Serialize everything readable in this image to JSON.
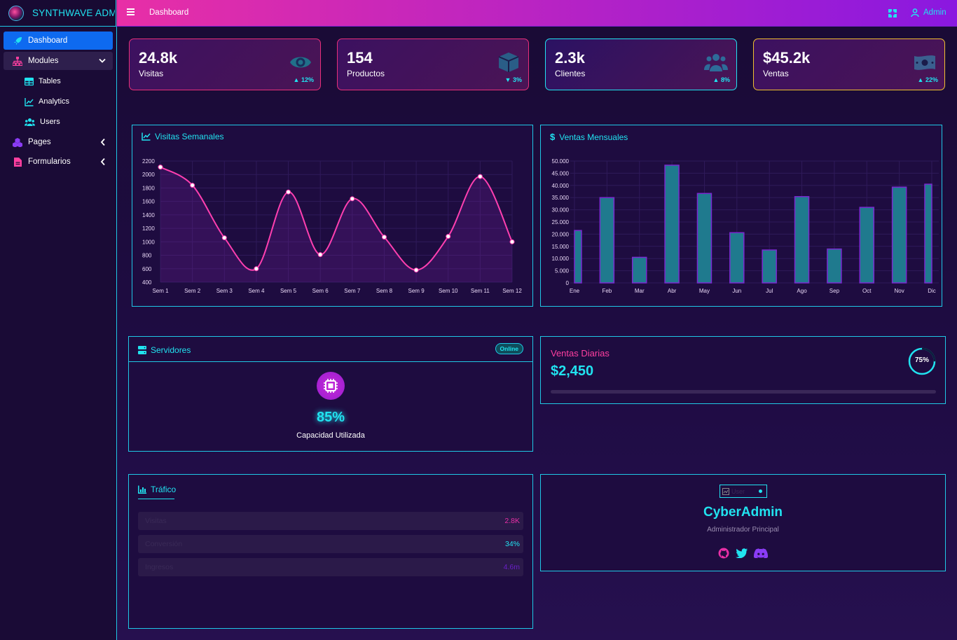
{
  "app": {
    "brand": "SYNTHWAVE ADMIN"
  },
  "topbar": {
    "breadcrumb": "Dashboard",
    "user": "Admin",
    "menu_icon": "bars-icon",
    "fullscreen_icon": "expand-icon"
  },
  "sidebar": {
    "items": [
      {
        "label": "Dashboard",
        "icon": "rocket-icon",
        "active": true
      },
      {
        "label": "Modules",
        "icon": "sitemap-icon",
        "expanded": true,
        "children": [
          {
            "label": "Tables",
            "icon": "table-icon"
          },
          {
            "label": "Analytics",
            "icon": "chart-line-icon"
          },
          {
            "label": "Users",
            "icon": "users-icon"
          }
        ]
      },
      {
        "label": "Pages",
        "icon": "cubes-icon"
      },
      {
        "label": "Formularios",
        "icon": "file-icon"
      }
    ]
  },
  "stats": [
    {
      "value": "24.8k",
      "label": "Visitas",
      "trend": "12%",
      "direction": "up",
      "icon": "eye-icon",
      "color": "#e82f7a"
    },
    {
      "value": "154",
      "label": "Productos",
      "trend": "3%",
      "direction": "down",
      "icon": "box-icon",
      "color": "#e82f7a"
    },
    {
      "value": "2.3k",
      "label": "Clientes",
      "trend": "8%",
      "direction": "up",
      "icon": "users-icon",
      "color": "#21e3f0"
    },
    {
      "value": "$45.2k",
      "label": "Ventas",
      "trend": "22%",
      "direction": "up",
      "icon": "money-icon",
      "color": "#f0c030"
    }
  ],
  "weekly_chart": {
    "title": "Visitas Semanales"
  },
  "monthly_chart": {
    "title": "Ventas Mensuales"
  },
  "chart_data": [
    {
      "type": "line",
      "title": "Visitas Semanales",
      "categories": [
        "Sem 1",
        "Sem 2",
        "Sem 3",
        "Sem 4",
        "Sem 5",
        "Sem 6",
        "Sem 7",
        "Sem 8",
        "Sem 9",
        "Sem 10",
        "Sem 11",
        "Sem 12"
      ],
      "values": [
        2110,
        1840,
        1060,
        600,
        1740,
        810,
        1640,
        1070,
        580,
        1080,
        1970,
        1000
      ],
      "yticks": [
        400,
        600,
        800,
        1000,
        1200,
        1400,
        1600,
        1800,
        2000,
        2200
      ],
      "ylim": [
        400,
        2200
      ],
      "grid": true,
      "color": "#ff3fb0"
    },
    {
      "type": "bar",
      "title": "Ventas Mensuales",
      "categories": [
        "Ene",
        "Feb",
        "Mar",
        "Abr",
        "May",
        "Jun",
        "Jul",
        "Ago",
        "Sep",
        "Oct",
        "Nov",
        "Dic"
      ],
      "values": [
        21500,
        35000,
        10500,
        48300,
        36700,
        20600,
        13500,
        35400,
        13900,
        31000,
        39300,
        40500
      ],
      "yticks": [
        "0",
        "5.000",
        "10.000",
        "15.000",
        "20.000",
        "25.000",
        "30.000",
        "35.000",
        "40.000",
        "45.000",
        "50.000"
      ],
      "ylim": [
        0,
        50000
      ],
      "grid": true,
      "color": "#1f7a8e"
    }
  ],
  "servers": {
    "title": "Servidores",
    "status": "Online",
    "percent": "85%",
    "caption": "Capacidad Utilizada",
    "icon": "microchip-icon"
  },
  "daily_sales": {
    "title": "Ventas Diarias",
    "value": "$2,450",
    "progress_label": "75%",
    "progress": 0.75
  },
  "traffic": {
    "title": "Tráfico",
    "rows": [
      {
        "label": "Visitas",
        "value": "2.8K",
        "color": "#e82fa6"
      },
      {
        "label": "Conversión",
        "value": "34%",
        "color": "#21e3f0"
      },
      {
        "label": "Ingresos",
        "value": "4.6m",
        "color": "#6a1fc8"
      }
    ]
  },
  "profile": {
    "avatar_alt": "User",
    "name": "CyberAdmin",
    "role": "Administrador Principal",
    "social": [
      "github-icon",
      "twitter-icon",
      "discord-icon"
    ]
  }
}
